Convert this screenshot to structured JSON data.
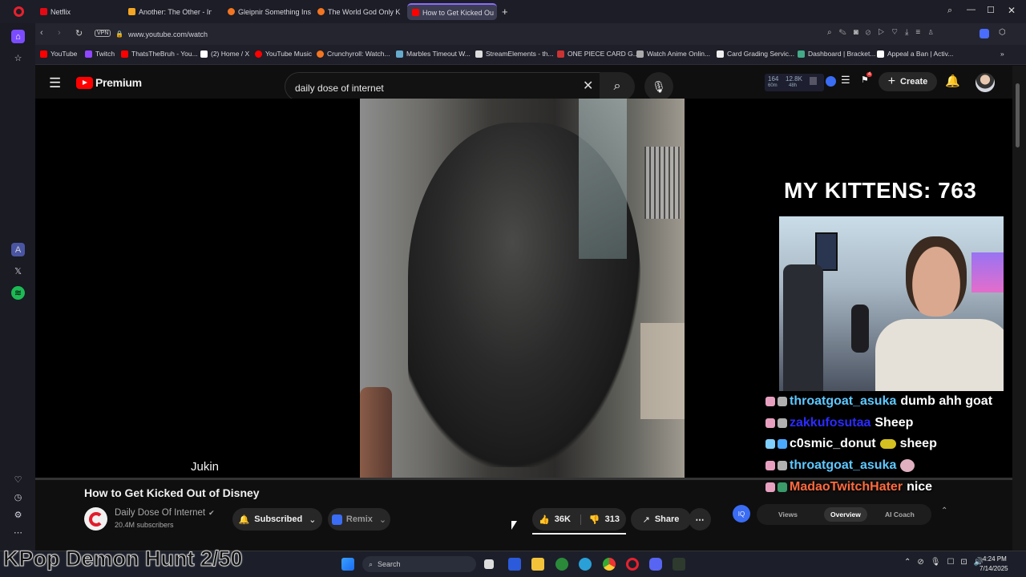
{
  "browser": {
    "tabs": [
      {
        "label": "Netflix",
        "color": "#e50914"
      },
      {
        "label": "Another: The Other - Inga",
        "color": "#f5a623"
      },
      {
        "label": "Gleipnir Something Inside",
        "color": "#f47521"
      },
      {
        "label": "The World God Only Know",
        "color": "#f47521"
      },
      {
        "label": "How to Get Kicked Ou",
        "color": "#ff0000"
      }
    ],
    "url": "www.youtube.com/watch",
    "vpn": "VPN",
    "bookmarks": [
      {
        "label": "YouTube",
        "color": "#ff0000"
      },
      {
        "label": "Twitch",
        "color": "#9146ff"
      },
      {
        "label": "ThatsTheBruh - You...",
        "color": "#ff0000"
      },
      {
        "label": "(2) Home / X",
        "color": "#ffffff"
      },
      {
        "label": "YouTube Music",
        "color": "#ff0000"
      },
      {
        "label": "Crunchyroll: Watch...",
        "color": "#f47521"
      },
      {
        "label": "Marbles Timeout W...",
        "color": "#6ac"
      },
      {
        "label": "StreamElements - th...",
        "color": "#ddd"
      },
      {
        "label": "ONE PIECE CARD G...",
        "color": "#c33"
      },
      {
        "label": "Watch Anime Onlin...",
        "color": "#aaa"
      },
      {
        "label": "Card Grading Servic...",
        "color": "#eee"
      },
      {
        "label": "Dashboard | Bracket...",
        "color": "#4a8"
      },
      {
        "label": "Appeal a Ban | Activ...",
        "color": "#fff"
      }
    ]
  },
  "youtube": {
    "logo_text": "Premium",
    "search_value": "daily dose of internet",
    "stats": {
      "a": "164",
      "a_sub": "60m",
      "b": "12.8K",
      "b_sub": "48h"
    },
    "notif_count": "4",
    "create_label": "Create",
    "video_title": "How to Get Kicked Out of Disney",
    "watermark": "Jukin",
    "channel": {
      "name": "Daily Dose Of Internet",
      "subs": "20.4M subscribers"
    },
    "subscribed_label": "Subscribed",
    "remix_label": "Remix",
    "likes": "36K",
    "dislikes": "313",
    "share_label": "Share",
    "panel_tabs": [
      "Views",
      "Overview",
      "AI Coach"
    ]
  },
  "stream_overlay": {
    "kittens": "MY KITTENS: 763",
    "chat": [
      {
        "user": "throatgoat_asuka",
        "msg": "dumb ahh goat",
        "color": "#5ec8ff"
      },
      {
        "user": "zakkufosutaa",
        "msg": "Sheep",
        "color": "#2b2bff"
      },
      {
        "user": "c0smic_donut",
        "msg": "sheep",
        "color": "#ffffff"
      },
      {
        "user": "throatgoat_asuka",
        "msg": "",
        "color": "#5ec8ff"
      },
      {
        "user": "MadaoTwitchHater",
        "msg": "nice",
        "color": "#ff6a3d"
      }
    ],
    "bottom_text": "KPop Demon Hunt 2/50"
  },
  "taskbar": {
    "search": "Search",
    "time": "4:24 PM",
    "date": "7/14/2025"
  }
}
